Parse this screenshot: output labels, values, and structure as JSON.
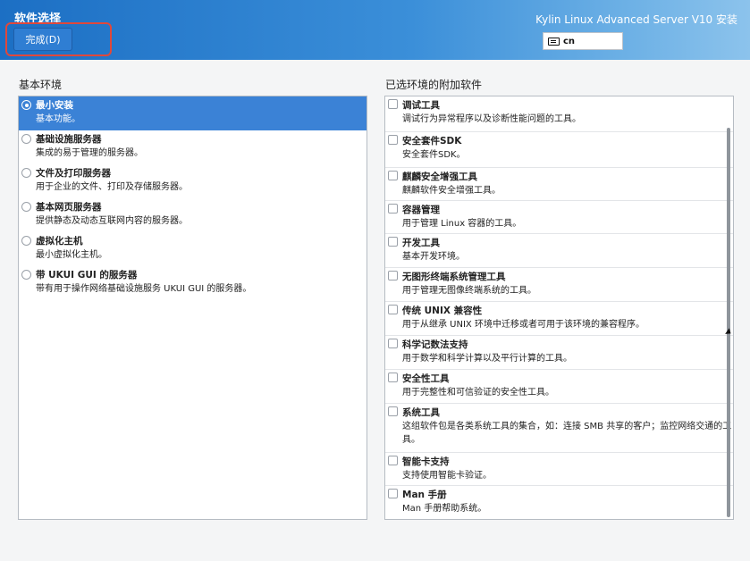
{
  "header": {
    "title": "软件选择",
    "done_label": "完成(D)",
    "product": "Kylin Linux Advanced Server V10 安装",
    "keyboard_layout": "cn",
    "accent": "#2f7ed3",
    "highlight_color": "#e0483b"
  },
  "base_env": {
    "label": "基本环境",
    "items": [
      {
        "name": "最小安装",
        "desc": "基本功能。",
        "selected": true
      },
      {
        "name": "基础设施服务器",
        "desc": "集成的易于管理的服务器。",
        "selected": false
      },
      {
        "name": "文件及打印服务器",
        "desc": "用于企业的文件、打印及存储服务器。",
        "selected": false
      },
      {
        "name": "基本网页服务器",
        "desc": "提供静态及动态互联网内容的服务器。",
        "selected": false
      },
      {
        "name": "虚拟化主机",
        "desc": "最小虚拟化主机。",
        "selected": false
      },
      {
        "name": "带 UKUI GUI 的服务器",
        "desc": "带有用于操作网络基础设施服务 UKUI GUI 的服务器。",
        "selected": false
      }
    ]
  },
  "addons": {
    "label": "已选环境的附加软件",
    "items": [
      {
        "name": "调试工具",
        "desc": "调试行为异常程序以及诊断性能问题的工具。"
      },
      {
        "name": "安全套件SDK",
        "desc": "安全套件SDK。"
      },
      {
        "name": "麒麟安全增强工具",
        "desc": "麒麟软件安全增强工具。"
      },
      {
        "name": "容器管理",
        "desc": "用于管理 Linux 容器的工具。"
      },
      {
        "name": "开发工具",
        "desc": "基本开发环境。"
      },
      {
        "name": "无图形终端系统管理工具",
        "desc": "用于管理无图像终端系统的工具。"
      },
      {
        "name": "传统 UNIX 兼容性",
        "desc": "用于从继承 UNIX 环境中迁移或者可用于该环境的兼容程序。"
      },
      {
        "name": "科学记数法支持",
        "desc": "用于数学和科学计算以及平行计算的工具。"
      },
      {
        "name": "安全性工具",
        "desc": "用于完整性和可信验证的安全性工具。"
      },
      {
        "name": "系统工具",
        "desc": "这组软件包是各类系统工具的集合，如：连接 SMB 共享的客户；监控网络交通的工具。"
      },
      {
        "name": "智能卡支持",
        "desc": "支持使用智能卡验证。"
      },
      {
        "name": "Man 手册",
        "desc": "Man 手册帮助系统。"
      }
    ]
  }
}
